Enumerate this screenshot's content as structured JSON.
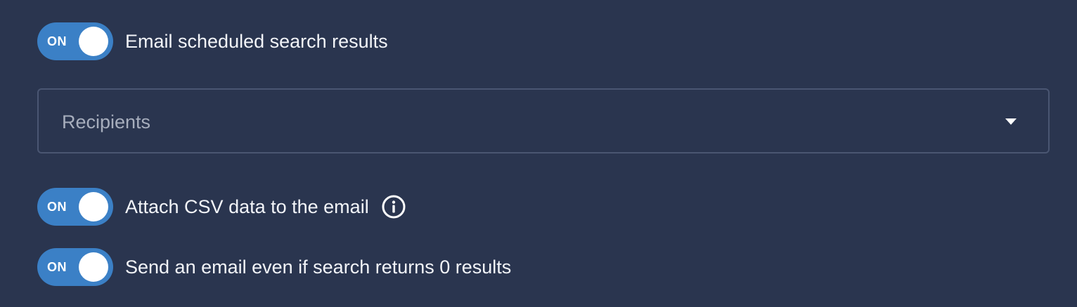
{
  "email_toggle": {
    "state_label": "ON",
    "label": "Email scheduled search results"
  },
  "recipients": {
    "placeholder": "Recipients"
  },
  "attach_csv_toggle": {
    "state_label": "ON",
    "label": "Attach CSV data to the email",
    "info_icon": "info-circle-icon"
  },
  "send_empty_toggle": {
    "state_label": "ON",
    "label": "Send an email even if search returns 0 results"
  },
  "colors": {
    "background": "#2a354f",
    "toggle_on": "#3b80c6",
    "border": "#4a5672",
    "text": "#f2f4f8",
    "placeholder": "#a7aebd"
  }
}
